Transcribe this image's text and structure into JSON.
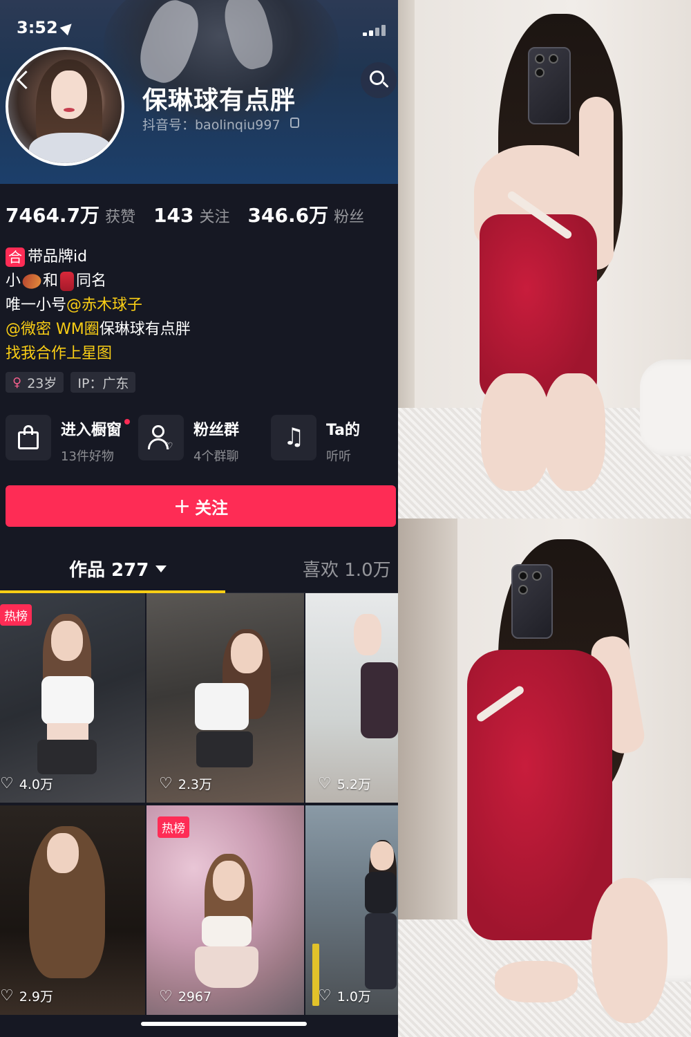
{
  "status_bar": {
    "time": "3:52"
  },
  "profile": {
    "nickname": "保琳球有点胖",
    "douyin_id": "抖音号：baolinqiu997",
    "stats": [
      {
        "value": "7464.7万",
        "label": "获赞"
      },
      {
        "value": "143",
        "label": "关注"
      },
      {
        "value": "346.6万",
        "label": "粉丝"
      }
    ],
    "bio": {
      "line1_badge": "合",
      "line1_text": "带品牌id",
      "line2_a": "小",
      "line2_b": "和",
      "line2_c": "同名",
      "line3_text": "唯一小号 ",
      "line3_link": "@赤木球子",
      "line4_link": "@微密 WM圈",
      "line4_text": " 保琳球有点胖",
      "line5_link": "找我合作上星图"
    },
    "tags": {
      "age": "23岁",
      "ip": "IP：广东"
    },
    "entries": [
      {
        "title": "进入橱窗",
        "subtitle": "13件好物"
      },
      {
        "title": "粉丝群",
        "subtitle": "4个群聊"
      },
      {
        "title": "Ta的",
        "subtitle": "听听"
      }
    ],
    "follow_label": "关注",
    "tabs": {
      "works": "作品 277",
      "likes": "喜欢 1.0万"
    },
    "videos": [
      {
        "likes": "4.0万",
        "hot": "热榜"
      },
      {
        "likes": "2.3万",
        "hot": ""
      },
      {
        "likes": "5.2万",
        "hot": ""
      },
      {
        "likes": "2.9万",
        "hot": ""
      },
      {
        "likes": "2967",
        "hot": "热榜"
      },
      {
        "likes": "1.0万",
        "hot": ""
      }
    ]
  },
  "colors": {
    "accent": "#fe2c55",
    "highlight": "#face15",
    "background": "#161823"
  }
}
